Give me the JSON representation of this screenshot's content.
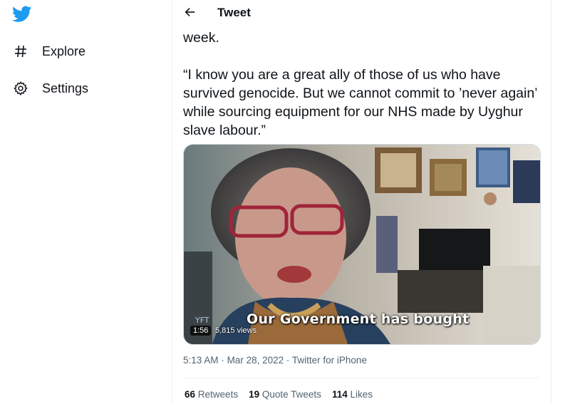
{
  "sidebar": {
    "logo_icon": "twitter-bird-icon",
    "brand_color": "#1d9bf0",
    "items": [
      {
        "label": "Explore",
        "icon": "hashtag-icon"
      },
      {
        "label": "Settings",
        "icon": "gear-icon"
      }
    ]
  },
  "header": {
    "back_icon": "arrow-left-icon",
    "title": "Tweet"
  },
  "tweet": {
    "text_line1": "week.",
    "quote": "“I know you are a great ally of those of us who have survived genocide. But we cannot commit to ’never again’ while sourcing equipment for our NHS made by Uyghur slave labour.”",
    "video": {
      "caption": "Our Government has bought",
      "watermark": "YFT",
      "duration": "1:56",
      "views": "5,815 views"
    },
    "time": "5:13 AM",
    "date": "Mar 28, 2022",
    "source": "Twitter for iPhone",
    "separator": "·",
    "stats": {
      "retweets_count": "66",
      "retweets_label": "Retweets",
      "quotes_count": "19",
      "quotes_label": "Quote Tweets",
      "likes_count": "114",
      "likes_label": "Likes"
    }
  }
}
